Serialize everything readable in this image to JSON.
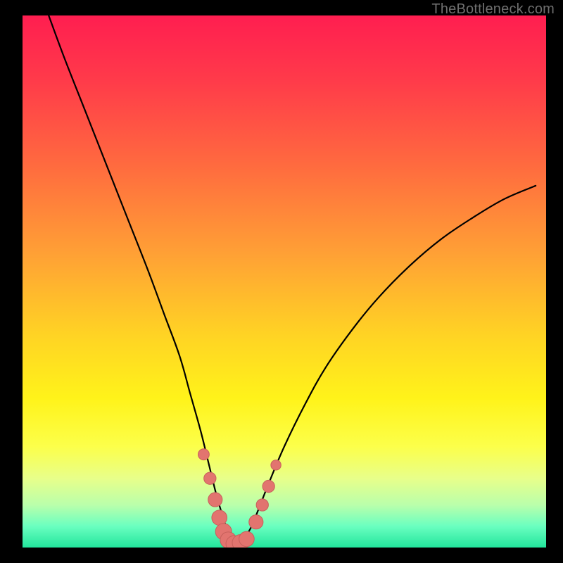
{
  "watermark": "TheBottleneck.com",
  "colors": {
    "frame": "#000000",
    "curve": "#000000",
    "marker_fill": "#e2746f",
    "marker_stroke": "#c7605b",
    "grad_stops": [
      {
        "offset": 0.0,
        "color": "#ff1e50"
      },
      {
        "offset": 0.12,
        "color": "#ff3a4a"
      },
      {
        "offset": 0.28,
        "color": "#ff6a3f"
      },
      {
        "offset": 0.45,
        "color": "#ffa135"
      },
      {
        "offset": 0.6,
        "color": "#ffd324"
      },
      {
        "offset": 0.72,
        "color": "#fff31a"
      },
      {
        "offset": 0.81,
        "color": "#fcff4a"
      },
      {
        "offset": 0.87,
        "color": "#e8ff8a"
      },
      {
        "offset": 0.92,
        "color": "#baffab"
      },
      {
        "offset": 0.96,
        "color": "#6affc0"
      },
      {
        "offset": 1.0,
        "color": "#22e59c"
      }
    ]
  },
  "chart_data": {
    "type": "line",
    "title": "",
    "xlabel": "",
    "ylabel": "",
    "xlim": [
      0,
      100
    ],
    "ylim": [
      0,
      100
    ],
    "grid": false,
    "legend": false,
    "series": [
      {
        "name": "bottleneck-curve",
        "x": [
          5,
          8,
          12,
          16,
          20,
          24,
          27,
          30,
          32,
          34,
          35.5,
          37,
          38.2,
          39.2,
          40,
          41,
          42,
          43.5,
          45,
          47,
          50,
          54,
          58,
          63,
          68,
          74,
          80,
          86,
          92,
          98
        ],
        "y": [
          100,
          92,
          82,
          72,
          62,
          52,
          44,
          36,
          29,
          22,
          16,
          10,
          6,
          3,
          1.2,
          0.6,
          1.4,
          3.5,
          7,
          12,
          19,
          27,
          34,
          41,
          47,
          53,
          58,
          62,
          65.5,
          68
        ]
      }
    ],
    "markers": [
      {
        "x": 34.6,
        "y": 17.5,
        "r": 1.1
      },
      {
        "x": 35.8,
        "y": 13.0,
        "r": 1.2
      },
      {
        "x": 36.8,
        "y": 9.0,
        "r": 1.4
      },
      {
        "x": 37.6,
        "y": 5.6,
        "r": 1.5
      },
      {
        "x": 38.4,
        "y": 3.0,
        "r": 1.6
      },
      {
        "x": 39.3,
        "y": 1.4,
        "r": 1.6
      },
      {
        "x": 40.4,
        "y": 0.7,
        "r": 1.6
      },
      {
        "x": 41.6,
        "y": 0.9,
        "r": 1.6
      },
      {
        "x": 42.8,
        "y": 1.6,
        "r": 1.5
      },
      {
        "x": 44.6,
        "y": 4.8,
        "r": 1.4
      },
      {
        "x": 45.8,
        "y": 8.0,
        "r": 1.2
      },
      {
        "x": 47.0,
        "y": 11.5,
        "r": 1.2
      },
      {
        "x": 48.4,
        "y": 15.5,
        "r": 1.0
      }
    ]
  }
}
